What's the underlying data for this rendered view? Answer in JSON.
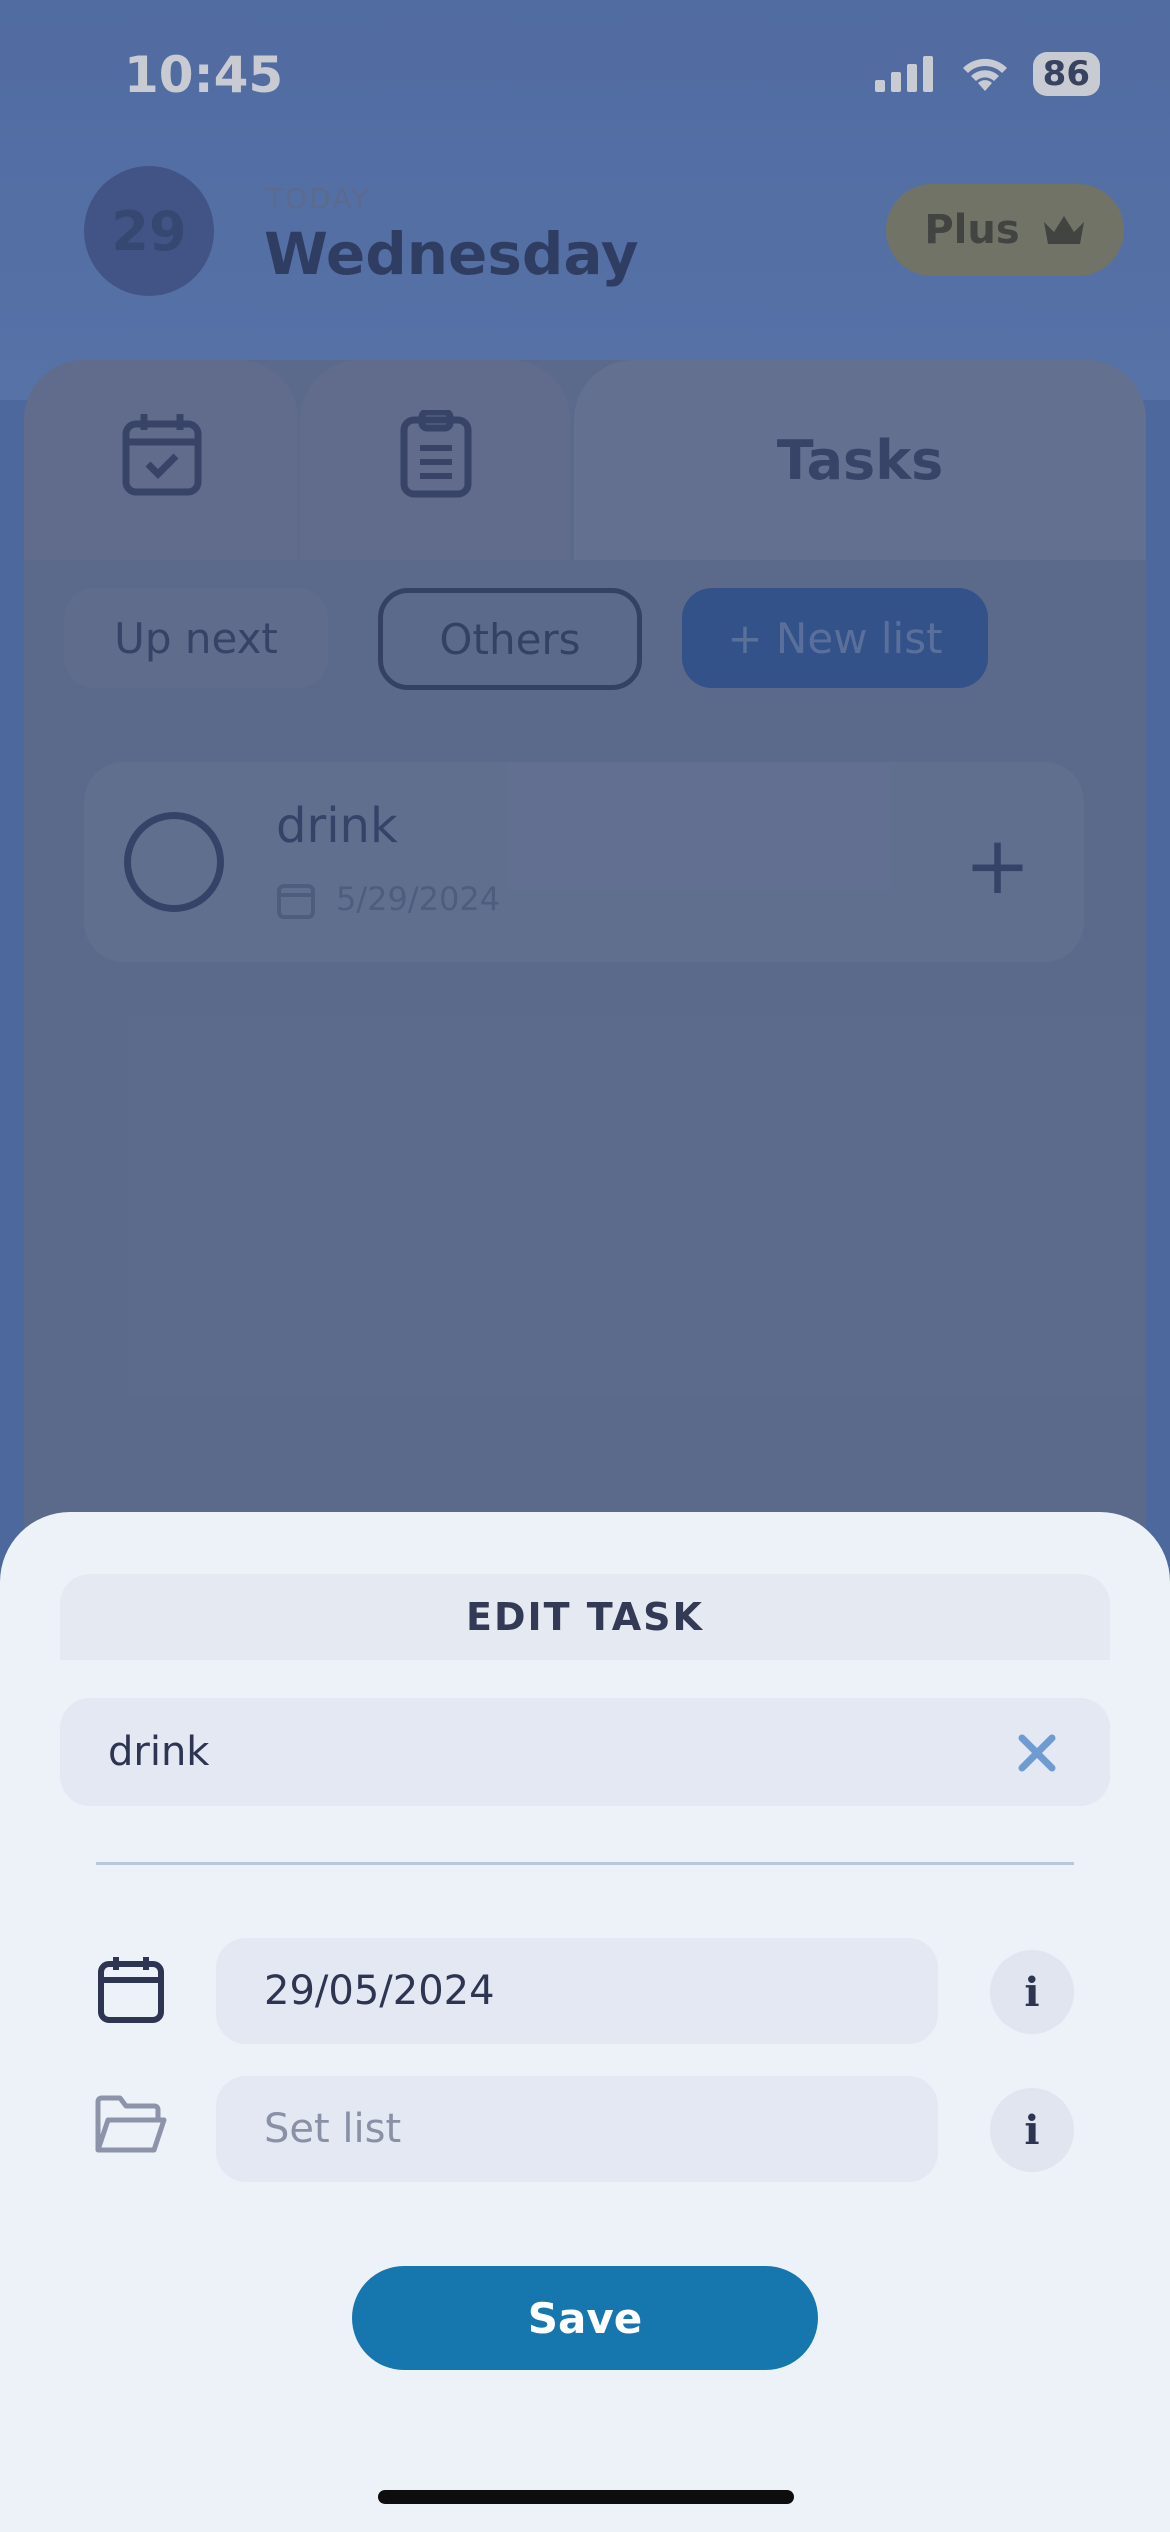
{
  "status_bar": {
    "time": "10:45",
    "battery": "86"
  },
  "header": {
    "day_number": "29",
    "today_label": "TODAY",
    "weekday": "Wednesday",
    "plus_label": "Plus"
  },
  "tabs": {
    "tasks_label": "Tasks"
  },
  "lists": {
    "up_next": "Up next",
    "others": "Others",
    "new_list": "+ New list"
  },
  "task": {
    "title": "drink",
    "date": "5/29/2024"
  },
  "edit_sheet": {
    "title": "EDIT TASK",
    "task_name": "drink",
    "date_value": "29/05/2024",
    "list_placeholder": "Set list",
    "info_label": "i",
    "save_label": "Save"
  },
  "colors": {
    "accent": "#1677ae",
    "sheet_bg": "#edf2f9"
  }
}
